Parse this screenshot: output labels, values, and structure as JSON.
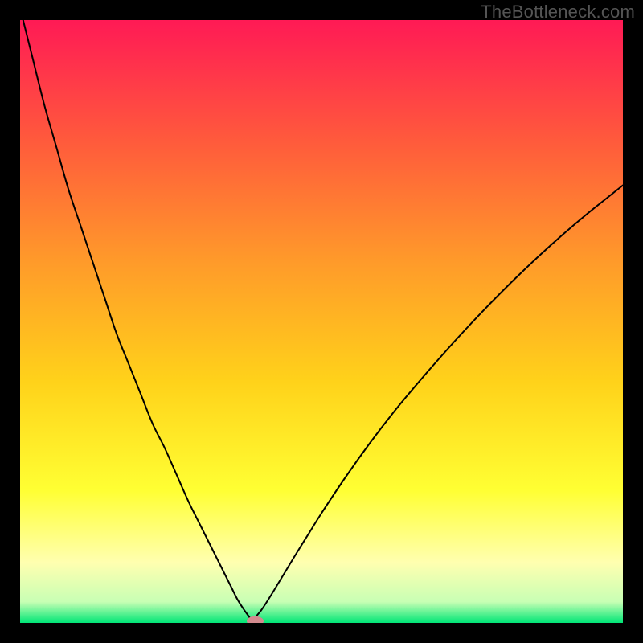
{
  "watermark": "TheBottleneck.com",
  "chart_data": {
    "type": "line",
    "title": "",
    "xlabel": "",
    "ylabel": "",
    "xlim": [
      0,
      100
    ],
    "ylim": [
      0,
      100
    ],
    "grid": false,
    "legend": false,
    "background_gradient": {
      "stops": [
        {
          "pos": 0.0,
          "color": "#ff1a55"
        },
        {
          "pos": 0.2,
          "color": "#ff5a3c"
        },
        {
          "pos": 0.4,
          "color": "#ff9a2a"
        },
        {
          "pos": 0.6,
          "color": "#ffd21a"
        },
        {
          "pos": 0.78,
          "color": "#ffff33"
        },
        {
          "pos": 0.9,
          "color": "#ffffb0"
        },
        {
          "pos": 0.965,
          "color": "#c8ffb4"
        },
        {
          "pos": 1.0,
          "color": "#00e676"
        }
      ]
    },
    "cusp_x": 38.5,
    "series": [
      {
        "name": "curve-left",
        "type": "line",
        "color": "#000000",
        "width": 2.0,
        "x": [
          0,
          2,
          4,
          6,
          8,
          10,
          12,
          14,
          16,
          18,
          20,
          22,
          24,
          26,
          28,
          30,
          32,
          34,
          35,
          36,
          37,
          38,
          38.5
        ],
        "y": [
          102,
          94,
          86,
          79,
          72,
          66,
          60,
          54,
          48,
          43,
          38,
          33,
          29,
          24.5,
          20,
          16,
          12,
          8,
          6,
          4,
          2.4,
          1.0,
          0.2
        ]
      },
      {
        "name": "curve-right",
        "type": "line",
        "color": "#000000",
        "width": 2.0,
        "x": [
          38.5,
          39,
          40,
          41,
          42,
          44,
          46,
          48,
          50,
          54,
          58,
          62,
          66,
          70,
          74,
          78,
          82,
          86,
          90,
          94,
          98,
          100
        ],
        "y": [
          0.2,
          0.9,
          2.1,
          3.6,
          5.2,
          8.5,
          11.8,
          15.0,
          18.2,
          24.2,
          29.8,
          35.0,
          39.8,
          44.4,
          48.8,
          53.0,
          57.0,
          60.8,
          64.4,
          67.8,
          71.0,
          72.6
        ]
      }
    ],
    "marker": {
      "x": 39.0,
      "y": 0.3,
      "rx": 1.4,
      "ry": 0.8,
      "color": "#d28a8e"
    }
  }
}
